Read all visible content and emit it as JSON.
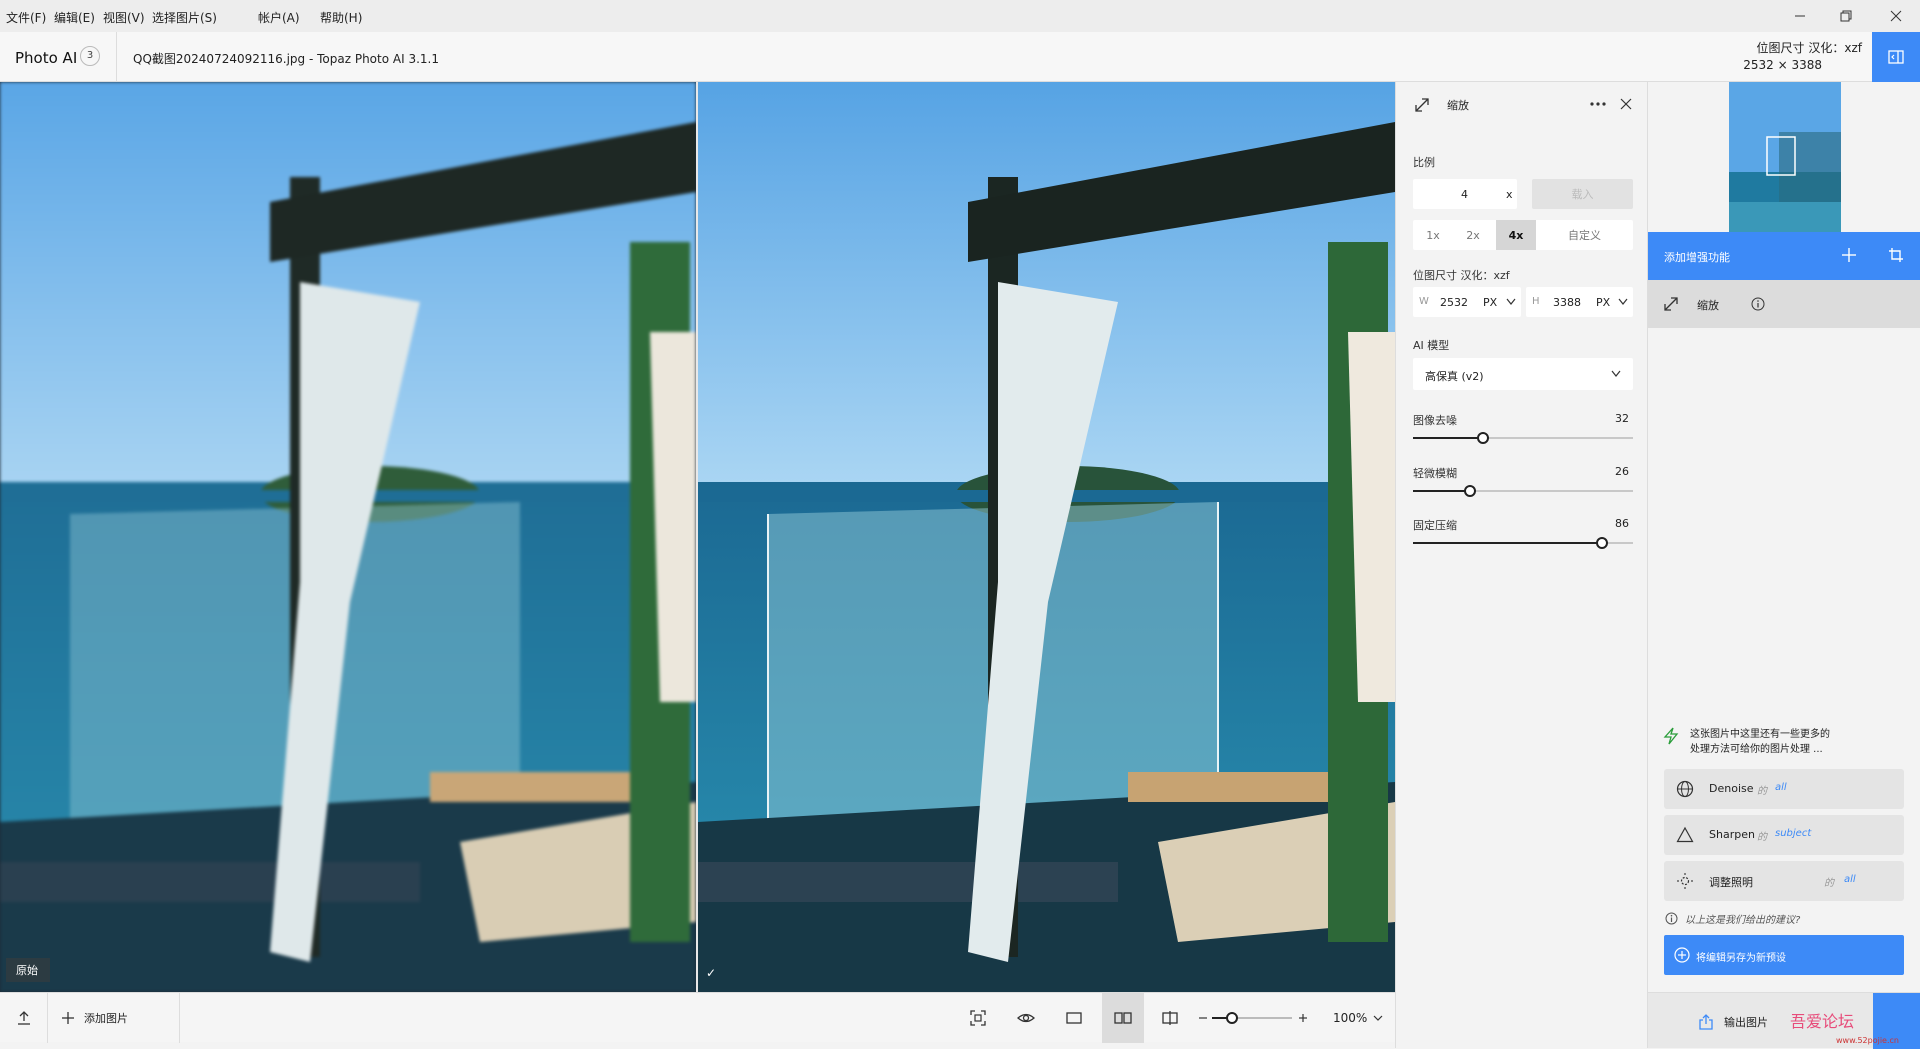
{
  "menubar": {
    "items": [
      "文件(F)",
      "编辑(E)",
      "视图(V)",
      "选择图片(S)",
      "帐户(A)",
      "帮助(H)"
    ]
  },
  "titlebar": {
    "app_name": "Photo AI",
    "badge": "3",
    "file_title": "QQ截图20240724092116.jpg - Topaz Photo AI 3.1.1",
    "dim_label": "位图尺寸 汉化：xzf",
    "dim_value": "2532 × 3388"
  },
  "canvas": {
    "original_label": "原始"
  },
  "bottombar": {
    "add_image": "添加图片",
    "zoom": "100%",
    "zoom_level": 0.25
  },
  "settings": {
    "title": "缩放",
    "scale_label": "比例",
    "scale_value": "4",
    "scale_unit": "x",
    "scale_apply": "载入",
    "presets": [
      "1x",
      "2x",
      "4x",
      "自定义"
    ],
    "active_preset": "4x",
    "size_label": "位图尺寸 汉化：xzf",
    "width_prefix": "W",
    "width_value": "2532",
    "height_prefix": "H",
    "height_value": "3388",
    "unit": "PX",
    "model_label": "AI 模型",
    "model_value": "高保真 (v2)",
    "sliders": [
      {
        "label": "图像去噪",
        "value": "32",
        "pct": 0.32
      },
      {
        "label": "轻微模糊",
        "value": "26",
        "pct": 0.26
      },
      {
        "label": "固定压缩",
        "value": "86",
        "pct": 0.86
      }
    ]
  },
  "rightpanel": {
    "add_enhancement": "添加增强功能",
    "active_filter": "缩放",
    "suggest_text_1": "这张图片中这里还有一些更多的",
    "suggest_text_2": "处理方法可给你的图片处理 ...",
    "suggestions": [
      {
        "name": "Denoise",
        "of": "的",
        "target": "all"
      },
      {
        "name": "Sharpen",
        "of": "的",
        "target": "subject"
      },
      {
        "name": "调整照明",
        "of": "的",
        "target": "all"
      }
    ],
    "info_text": "以上这是我们给出的建议?",
    "save_preset": "将编辑另存为新预设",
    "export": "输出图片"
  },
  "watermark": {
    "text": "吾爱论坛",
    "sub": "www.52pojie.cn"
  },
  "colors": {
    "accent": "#3d8af7"
  }
}
